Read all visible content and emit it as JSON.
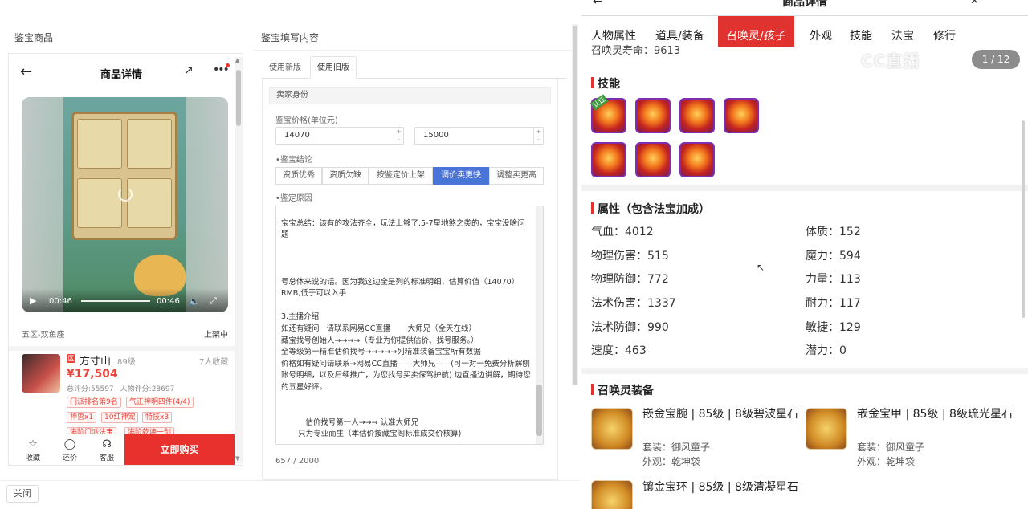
{
  "left": {
    "section_title": "鉴宝商品",
    "header": {
      "title": "商品详情"
    },
    "video": {
      "current_time": "00:46",
      "duration": "00:46"
    },
    "server": "五区-双鱼座",
    "status": "上架中",
    "seller": {
      "badge": "区",
      "name": "方寸山",
      "level": "89级",
      "favorites": "7人收藏",
      "price": "¥17,504",
      "total_score": "总评分:55597",
      "char_score": "人物评分:28697",
      "tags": [
        "门派排名第9名",
        "气正神明四件(4/4)",
        "神兽x1",
        "10红神宠",
        "特技x3",
        "满阶门派法宝",
        "满阶乾坤一剑"
      ]
    },
    "footer": {
      "fav": "收藏",
      "bargain": "还价",
      "service": "客服",
      "buy": "立即购买"
    },
    "close": "关闭"
  },
  "middle": {
    "section_title": "鉴宝填写内容",
    "tabs": [
      "使用新版",
      "使用旧版"
    ],
    "seller_identity": "卖家身份",
    "price_label": "鉴宝价格(单位元)",
    "price_min": "14070",
    "price_max": "15000",
    "conclusion_label": "鉴宝结论",
    "conclusion_options": [
      "资质优秀",
      "资质欠缺",
      "按鉴定价上架",
      "调价卖更快",
      "调整卖更高"
    ],
    "conclusion_selected": "调价卖更快",
    "reason_label": "鉴定原因",
    "reason_text": "\n宝宝总结：该有的攻法齐全，玩法上够了.5-7星地煞之类的，宝宝没啥问题\n\n\n\n号总体来说的话。因为我这边全是列的标准明细，估算价值（14070）RMB,低于可以入手\n\n3.主播介绍\n如还有疑问   请联系网易CC直播       大师兄（全天在线）\n藏宝找号创始人→→→→（专业为你提供估价、找号服务。）\n全等级第一精准估价找号→→→→→列精准装备宝宝所有数据\n价格如有疑问请联系→网易CC直播——大师兄——(可一对一免费分析解刨账号明细，以及后续推广，为您找号买卖保驾护航) 边直播边讲解，期待您的五星好评。\n\n\n          估价找号第一人→→→ 认准大师兄\n       只为专业而生（本估价按藏宝阁标准成交价核算)",
    "counter": "657 / 2000"
  },
  "right": {
    "header_title": "商品详情",
    "tabs": [
      "人物属性",
      "道具/装备",
      "召唤灵/孩子",
      "外观",
      "技能",
      "法宝",
      "修行"
    ],
    "active_tab": "召唤灵/孩子",
    "cut_text": "召唤灵寿命：9613",
    "watermark": "CC直播",
    "page_indicator": "1 / 12",
    "skills_title": "技能",
    "skill_ribbon": "认证",
    "attrs_title": "属性（包含法宝加成）",
    "attrs": [
      {
        "label": "气血：",
        "value": "4012"
      },
      {
        "label": "体质：",
        "value": "152"
      },
      {
        "label": "物理伤害：",
        "value": "515"
      },
      {
        "label": "魔力：",
        "value": "594"
      },
      {
        "label": "物理防御：",
        "value": "772"
      },
      {
        "label": "力量：",
        "value": "113"
      },
      {
        "label": "法术伤害：",
        "value": "1337"
      },
      {
        "label": "耐力：",
        "value": "117"
      },
      {
        "label": "法术防御：",
        "value": "990"
      },
      {
        "label": "敏捷：",
        "value": "129"
      },
      {
        "label": "速度：",
        "value": "463"
      },
      {
        "label": "潜力：",
        "value": "0"
      }
    ],
    "equip_title": "召唤灵装备",
    "equips": [
      {
        "name": "嵌金宝腕 | 85级 | 8级碧波星石",
        "set": "套装：御风童子",
        "look": "外观：乾坤袋"
      },
      {
        "name": "嵌金宝甲 | 85级 | 8级琉光星石",
        "set": "套装：御风童子",
        "look": "外观：乾坤袋"
      },
      {
        "name": "镶金宝环 | 85级 | 8级清凝星石",
        "set": "",
        "look": ""
      }
    ]
  },
  "colors": {
    "accent_red": "#e0332f",
    "select_blue": "#4b74d8",
    "price_red": "#e8453c"
  }
}
